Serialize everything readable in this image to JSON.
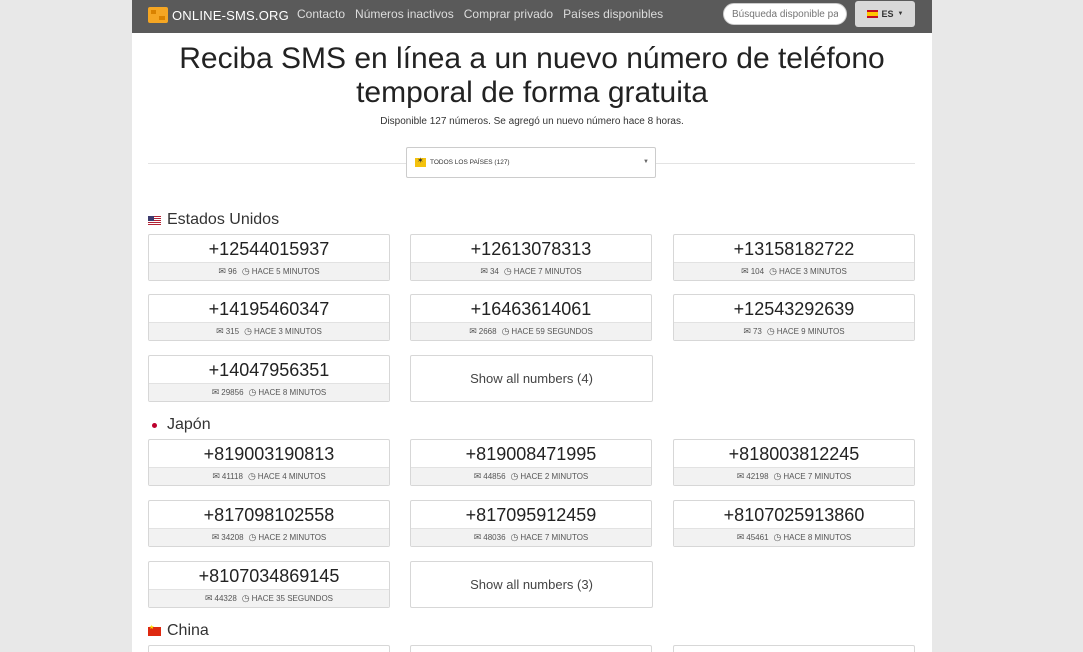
{
  "nav": {
    "brand": "ONLINE-SMS.ORG",
    "links": [
      "Contacto",
      "Números inactivos",
      "Comprar privado",
      "Países disponibles"
    ],
    "search_placeholder": "Búsqueda disponible para",
    "lang": "ES"
  },
  "hero": {
    "title_line1": "Reciba SMS en línea a un nuevo número de teléfono",
    "title_line2": "temporal de forma gratuita",
    "sub_a": "Disponible ",
    "sub_b": "127 números",
    "sub_c": ". Se agregó un nuevo número ",
    "sub_d": "hace 8 horas",
    "sub_e": "."
  },
  "filter": {
    "selected": "TODOS LOS PAÍSES (127)"
  },
  "sections": [
    {
      "country": "Estados Unidos",
      "numbers": [
        {
          "number": "+12544015937",
          "count": "96",
          "time": "HACE 5 MINUTOS"
        },
        {
          "number": "+12613078313",
          "count": "34",
          "time": "HACE 7 MINUTOS"
        },
        {
          "number": "+13158182722",
          "count": "104",
          "time": "HACE 3 MINUTOS"
        },
        {
          "number": "+14195460347",
          "count": "315",
          "time": "HACE 3 MINUTOS"
        },
        {
          "number": "+16463614061",
          "count": "2668",
          "time": "HACE 59 SEGUNDOS"
        },
        {
          "number": "+12543292639",
          "count": "73",
          "time": "HACE 9 MINUTOS"
        },
        {
          "number": "+14047956351",
          "count": "29856",
          "time": "HACE 8 MINUTOS"
        }
      ],
      "show_all": "Show all numbers (4)"
    },
    {
      "country": "Japón",
      "numbers": [
        {
          "number": "+819003190813",
          "count": "41118",
          "time": "HACE 4 MINUTOS"
        },
        {
          "number": "+819008471995",
          "count": "44856",
          "time": "HACE 2 MINUTOS"
        },
        {
          "number": "+818003812245",
          "count": "42198",
          "time": "HACE 7 MINUTOS"
        },
        {
          "number": "+817098102558",
          "count": "34208",
          "time": "HACE 2 MINUTOS"
        },
        {
          "number": "+817095912459",
          "count": "48036",
          "time": "HACE 7 MINUTOS"
        },
        {
          "number": "+8107025913860",
          "count": "45461",
          "time": "HACE 8 MINUTOS"
        },
        {
          "number": "+8107034869145",
          "count": "44328",
          "time": "HACE 35 SEGUNDOS"
        }
      ],
      "show_all": "Show all numbers (3)"
    },
    {
      "country": "China"
    }
  ]
}
